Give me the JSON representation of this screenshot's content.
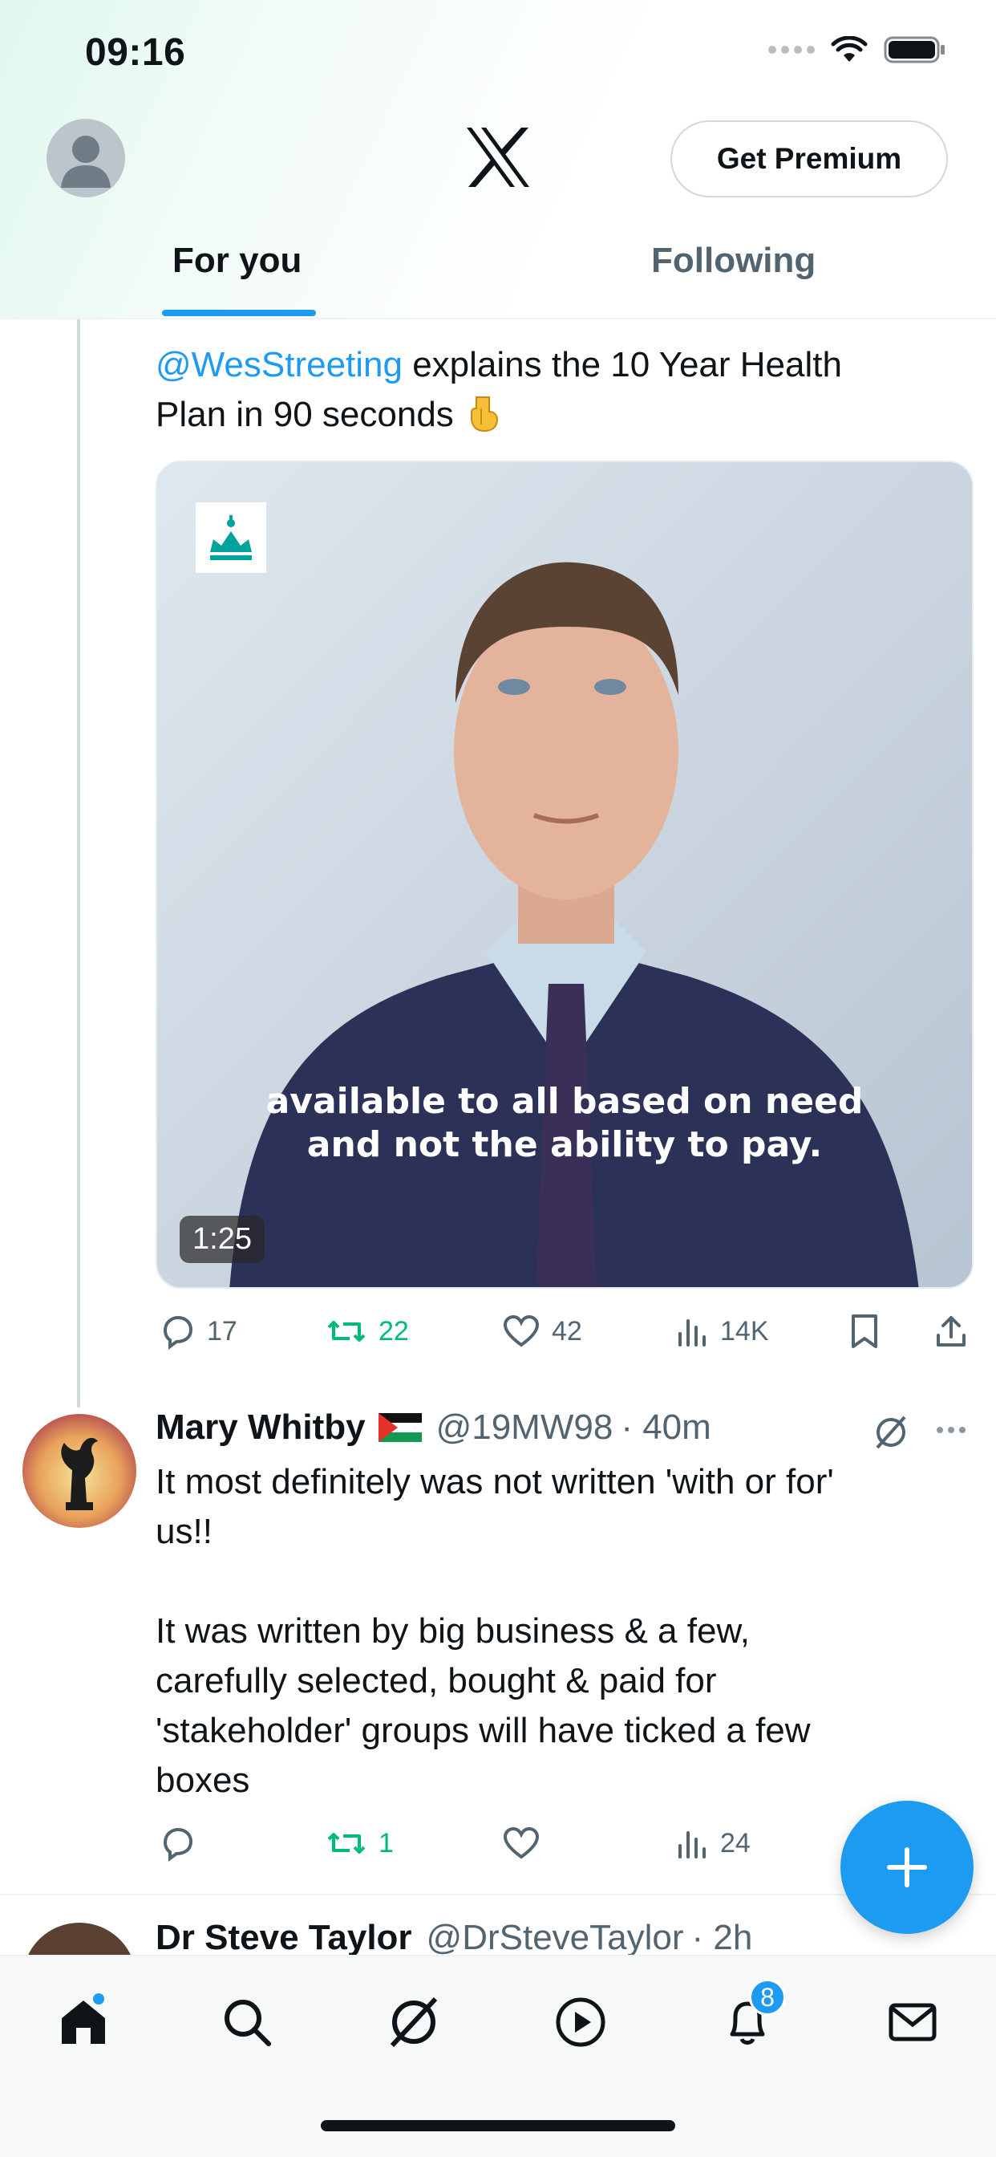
{
  "status_bar": {
    "time": "09:16"
  },
  "header": {
    "premium_label": "Get Premium",
    "tabs": [
      {
        "label": "For you",
        "active": true
      },
      {
        "label": "Following",
        "active": false
      }
    ]
  },
  "tweet1": {
    "mention": "@WesStreeting",
    "text_line1_rest": " explains the 10 Year Health",
    "text_line2": "Plan in 90 seconds",
    "emoji": "pointing-down-emoji",
    "video": {
      "caption_line1": "available to all based on need",
      "caption_line2": "and not the ability to pay.",
      "duration": "1:25"
    },
    "actions": {
      "replies": "17",
      "reposts": "22",
      "likes": "42",
      "views": "14K"
    }
  },
  "tweet2": {
    "name": "Mary Whitby",
    "handle": "@19MW98",
    "time": "· 40m",
    "paragraphs": [
      [
        "It most definitely was not written 'with or for'",
        "us!!"
      ],
      [
        "It was written by big business & a few,",
        "carefully selected, bought & paid for",
        "'stakeholder' groups will have ticked a few",
        "boxes"
      ]
    ],
    "actions": {
      "replies": "",
      "reposts": "1",
      "likes": "",
      "views": "24"
    }
  },
  "tweet3": {
    "name": "Dr Steve Taylor",
    "handle": "@DrSteveTaylor",
    "time": "· 2h"
  },
  "bottom_nav": {
    "items": [
      "home-icon",
      "search-icon",
      "grok-icon",
      "video-icon",
      "notifications-icon",
      "messages-icon"
    ],
    "notification_count": "8"
  },
  "colors": {
    "accent": "#1d9bf0",
    "repost": "#00ba7c",
    "muted": "#536471"
  }
}
